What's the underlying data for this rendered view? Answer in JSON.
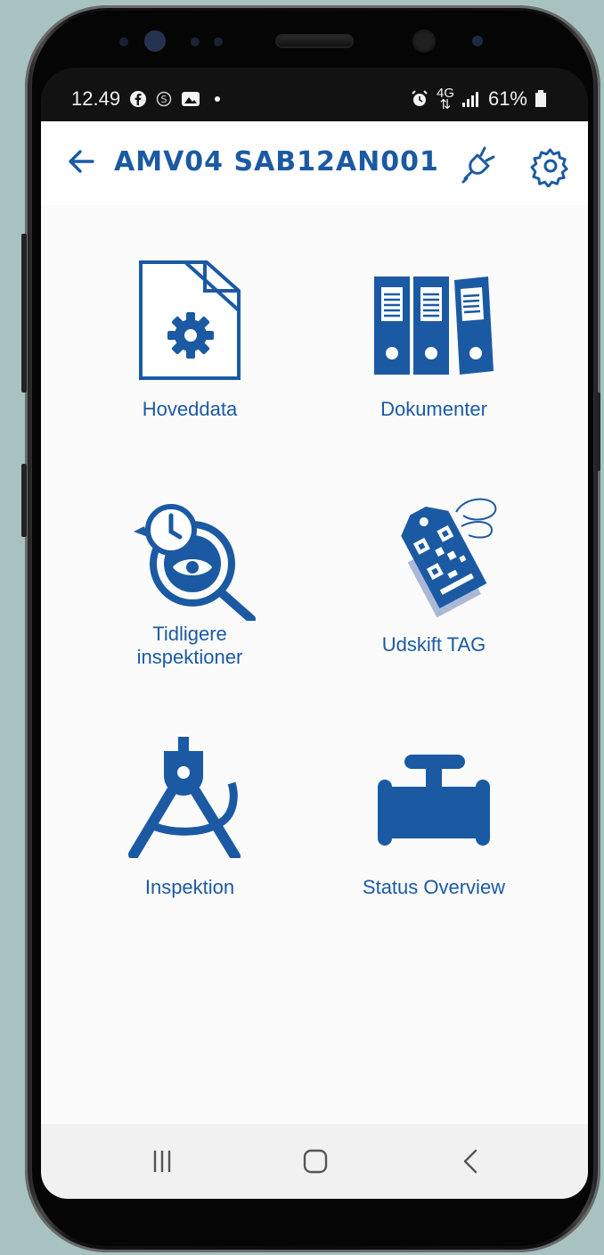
{
  "status_bar": {
    "time": "12.49",
    "battery": "61%",
    "network": "4G"
  },
  "app_bar": {
    "title": "AMV04 SAB12AN001",
    "back_icon": "arrow-left-icon",
    "connect_icon": "plug-icon",
    "settings_icon": "gear-icon"
  },
  "menu": [
    {
      "label": "Hoveddata",
      "icon": "document-gear-icon"
    },
    {
      "label": "Dokumenter",
      "icon": "binders-icon"
    },
    {
      "label": "Tidligere",
      "label2": "inspektioner",
      "icon": "history-magnifier-icon"
    },
    {
      "label": "Udskift TAG",
      "icon": "qr-tag-icon"
    },
    {
      "label": "Inspektion",
      "icon": "compass-icon"
    },
    {
      "label": "Status Overview",
      "icon": "valve-icon"
    }
  ],
  "nav_bar": [
    "recent-apps-icon",
    "home-icon",
    "back-chevron-icon"
  ],
  "colors": {
    "accent": "#1b5aa3",
    "background": "#a7c2c1",
    "screen": "#fbfbfb"
  }
}
